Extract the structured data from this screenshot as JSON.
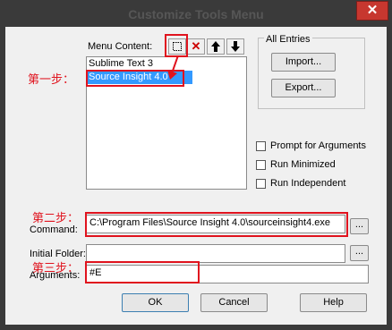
{
  "dialog": {
    "title": "Customize Tools Menu",
    "close_icon": "✕"
  },
  "menu_content": {
    "label": "Menu Content:",
    "items": [
      "Sublime Text 3",
      "Source Insight 4.0"
    ],
    "selected_index": 1
  },
  "toolbar": {
    "new_icon": "new-item",
    "delete_icon": "✕",
    "up_icon": "🡅",
    "down_icon": "🡇"
  },
  "all_entries": {
    "label": "All Entries",
    "import": "Import...",
    "export": "Export..."
  },
  "options": {
    "prompt_arguments": "Prompt for  Arguments",
    "run_minimized": "Run Minimized",
    "run_independent": "Run Independent"
  },
  "fields": {
    "command_label": "Command:",
    "command_value": "C:\\Program Files\\Source Insight 4.0\\sourceinsight4.exe",
    "initial_folder_label": "Initial Folder:",
    "initial_folder_value": "",
    "arguments_label": "Arguments:",
    "arguments_value": "#E",
    "browse": "..."
  },
  "buttons": {
    "ok": "OK",
    "cancel": "Cancel",
    "help": "Help"
  },
  "annotations": {
    "step1": "第一步：",
    "step2": "第二步：",
    "step3": "第三步："
  },
  "colors": {
    "annotation": "#e0131e",
    "selection": "#3399ff"
  }
}
